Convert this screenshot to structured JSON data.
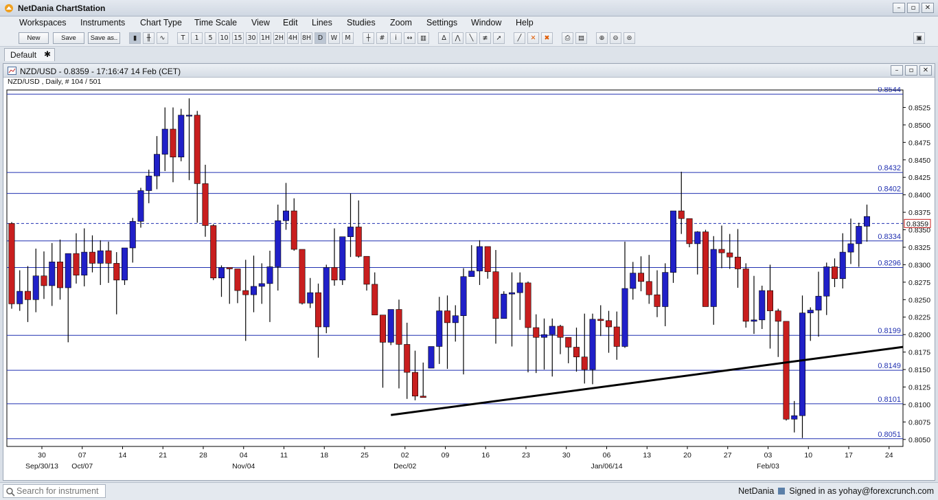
{
  "app": {
    "title": "NetDania ChartStation"
  },
  "menu": [
    "Workspaces",
    "Instruments",
    "Chart Type",
    "Time Scale",
    "View",
    "Edit",
    "Lines",
    "Studies",
    "Zoom",
    "Settings",
    "Window",
    "Help"
  ],
  "toolbar": {
    "new_label": "New",
    "save_label": "Save",
    "saveas_label": "Save as..",
    "timescales": [
      "T",
      "1",
      "5",
      "10",
      "15",
      "30",
      "1H",
      "2H",
      "4H",
      "8H",
      "D",
      "W",
      "M"
    ],
    "active_timescale": "D"
  },
  "workspace_tab": {
    "label": "Default",
    "close": "✱"
  },
  "chart_window": {
    "title": "NZD/USD - 0.8359 - 17:16:47  14 Feb (CET)",
    "subtitle": "NZD/USD , Daily, # 104 / 501"
  },
  "chart_data": {
    "type": "candlestick",
    "instrument": "NZD/USD",
    "ylim": [
      0.804,
      0.855
    ],
    "yticks": [
      "0.8525",
      "0.8500",
      "0.8475",
      "0.8450",
      "0.8425",
      "0.8400",
      "0.8375",
      "0.8350",
      "0.8325",
      "0.8300",
      "0.8275",
      "0.8250",
      "0.8225",
      "0.8200",
      "0.8175",
      "0.8150",
      "0.8125",
      "0.8100",
      "0.8075",
      "0.8050"
    ],
    "xticks": [
      "30",
      "07",
      "14",
      "21",
      "28",
      "04",
      "11",
      "18",
      "25",
      "02",
      "09",
      "16",
      "23",
      "30",
      "06",
      "13",
      "20",
      "27",
      "03",
      "10",
      "17",
      "24"
    ],
    "period_labels": [
      {
        "text": "Sep/30/13",
        "tick": 0
      },
      {
        "text": "Oct/07",
        "tick": 1
      },
      {
        "text": "Nov/04",
        "tick": 5
      },
      {
        "text": "Dec/02",
        "tick": 9
      },
      {
        "text": "Jan/06/14",
        "tick": 14
      },
      {
        "text": "Feb/03",
        "tick": 18
      }
    ],
    "hlines": [
      "0.8544",
      "0.8432",
      "0.8402",
      "0.8334",
      "0.8296",
      "0.8199",
      "0.8149",
      "0.8101",
      "0.8051"
    ],
    "current_price": "0.8359",
    "trendline": {
      "from": {
        "bar": 47,
        "price": 0.8085
      },
      "to": {
        "bar": 107,
        "price": 0.8177
      }
    },
    "candles": [
      [
        0.8359,
        0.8361,
        0.8237,
        0.8244
      ],
      [
        0.8244,
        0.8292,
        0.8234,
        0.8262
      ],
      [
        0.8262,
        0.8298,
        0.8218,
        0.825
      ],
      [
        0.825,
        0.8323,
        0.8232,
        0.8284
      ],
      [
        0.8284,
        0.8319,
        0.8251,
        0.827
      ],
      [
        0.827,
        0.8331,
        0.8241,
        0.8304
      ],
      [
        0.8304,
        0.8336,
        0.825,
        0.8267
      ],
      [
        0.8267,
        0.8316,
        0.8189,
        0.8316
      ],
      [
        0.8316,
        0.8345,
        0.8273,
        0.8285
      ],
      [
        0.8285,
        0.8352,
        0.8269,
        0.8318
      ],
      [
        0.8318,
        0.8342,
        0.8289,
        0.8302
      ],
      [
        0.8302,
        0.8335,
        0.8271,
        0.832
      ],
      [
        0.832,
        0.8333,
        0.8274,
        0.8302
      ],
      [
        0.8302,
        0.8318,
        0.8229,
        0.8278
      ],
      [
        0.8278,
        0.8318,
        0.8271,
        0.8324
      ],
      [
        0.8324,
        0.8367,
        0.8303,
        0.8362
      ],
      [
        0.8362,
        0.841,
        0.8353,
        0.8406
      ],
      [
        0.8406,
        0.8436,
        0.8388,
        0.8427
      ],
      [
        0.8427,
        0.8484,
        0.8408,
        0.8458
      ],
      [
        0.8458,
        0.8525,
        0.8434,
        0.8494
      ],
      [
        0.8494,
        0.8525,
        0.8418,
        0.8454
      ],
      [
        0.8454,
        0.8523,
        0.8448,
        0.8514
      ],
      [
        0.8514,
        0.8538,
        0.8421,
        0.8514
      ],
      [
        0.8514,
        0.852,
        0.836,
        0.8416
      ],
      [
        0.8416,
        0.8443,
        0.834,
        0.8356
      ],
      [
        0.8356,
        0.8358,
        0.8278,
        0.8281
      ],
      [
        0.8281,
        0.8299,
        0.8254,
        0.8296
      ],
      [
        0.8296,
        0.8294,
        0.8244,
        0.8294
      ],
      [
        0.8294,
        0.8282,
        0.8245,
        0.8263
      ],
      [
        0.8263,
        0.8307,
        0.8191,
        0.8257
      ],
      [
        0.8257,
        0.8313,
        0.8232,
        0.8269
      ],
      [
        0.8269,
        0.8302,
        0.8244,
        0.8273
      ],
      [
        0.8273,
        0.832,
        0.8218,
        0.8297
      ],
      [
        0.8297,
        0.8386,
        0.8263,
        0.8363
      ],
      [
        0.8363,
        0.8417,
        0.835,
        0.8377
      ],
      [
        0.8377,
        0.8395,
        0.832,
        0.8322
      ],
      [
        0.8322,
        0.83,
        0.8243,
        0.8245
      ],
      [
        0.8245,
        0.8281,
        0.8238,
        0.826
      ],
      [
        0.826,
        0.8273,
        0.8167,
        0.8211
      ],
      [
        0.8211,
        0.83,
        0.8202,
        0.8296
      ],
      [
        0.8296,
        0.8352,
        0.827,
        0.8278
      ],
      [
        0.8278,
        0.834,
        0.8271,
        0.834
      ],
      [
        0.834,
        0.8402,
        0.8311,
        0.8354
      ],
      [
        0.8354,
        0.8392,
        0.831,
        0.8312
      ],
      [
        0.8312,
        0.83,
        0.8263,
        0.8272
      ],
      [
        0.8272,
        0.8289,
        0.8228,
        0.8228
      ],
      [
        0.8228,
        0.8206,
        0.8124,
        0.8189
      ],
      [
        0.8189,
        0.8224,
        0.8185,
        0.8236
      ],
      [
        0.8236,
        0.825,
        0.8123,
        0.8186
      ],
      [
        0.8186,
        0.8217,
        0.8108,
        0.8146
      ],
      [
        0.8146,
        0.8177,
        0.8106,
        0.8112
      ],
      [
        0.8112,
        0.816,
        0.811,
        0.811
      ],
      [
        0.8152,
        0.818,
        0.8152,
        0.8183
      ],
      [
        0.8183,
        0.8254,
        0.8158,
        0.8234
      ],
      [
        0.8234,
        0.8256,
        0.8151,
        0.8217
      ],
      [
        0.8217,
        0.8242,
        0.819,
        0.8227
      ],
      [
        0.8227,
        0.8295,
        0.8143,
        0.8283
      ],
      [
        0.8283,
        0.8328,
        0.8284,
        0.8291
      ],
      [
        0.8291,
        0.8335,
        0.8271,
        0.8326
      ],
      [
        0.8326,
        0.8306,
        0.828,
        0.829
      ],
      [
        0.829,
        0.8321,
        0.8187,
        0.8223
      ],
      [
        0.8223,
        0.8262,
        0.8225,
        0.8258
      ],
      [
        0.8258,
        0.8289,
        0.8183,
        0.826
      ],
      [
        0.826,
        0.8289,
        0.8221,
        0.8274
      ],
      [
        0.8274,
        0.8276,
        0.8146,
        0.821
      ],
      [
        0.821,
        0.8229,
        0.8145,
        0.8196
      ],
      [
        0.8196,
        0.8223,
        0.815,
        0.82
      ],
      [
        0.82,
        0.8223,
        0.814,
        0.8212
      ],
      [
        0.8212,
        0.8214,
        0.8172,
        0.8196
      ],
      [
        0.8196,
        0.8196,
        0.8159,
        0.8182
      ],
      [
        0.8182,
        0.821,
        0.8147,
        0.8168
      ],
      [
        0.8168,
        0.823,
        0.813,
        0.815
      ],
      [
        0.815,
        0.823,
        0.8129,
        0.8222
      ],
      [
        0.8222,
        0.8242,
        0.8198,
        0.822
      ],
      [
        0.822,
        0.8234,
        0.8174,
        0.8211
      ],
      [
        0.8211,
        0.8233,
        0.8164,
        0.8183
      ],
      [
        0.8183,
        0.8333,
        0.8181,
        0.8266
      ],
      [
        0.8266,
        0.8304,
        0.825,
        0.8288
      ],
      [
        0.8288,
        0.8312,
        0.8262,
        0.8276
      ],
      [
        0.8276,
        0.8314,
        0.8244,
        0.8257
      ],
      [
        0.8257,
        0.8292,
        0.8225,
        0.824
      ],
      [
        0.824,
        0.8302,
        0.8212,
        0.8289
      ],
      [
        0.8289,
        0.8373,
        0.8274,
        0.8377
      ],
      [
        0.8377,
        0.8433,
        0.8344,
        0.8366
      ],
      [
        0.8366,
        0.8366,
        0.8325,
        0.833
      ],
      [
        0.833,
        0.8348,
        0.8286,
        0.8347
      ],
      [
        0.8347,
        0.835,
        0.824,
        0.824
      ],
      [
        0.824,
        0.8341,
        0.8214,
        0.8322
      ],
      [
        0.8322,
        0.8356,
        0.8295,
        0.8317
      ],
      [
        0.8317,
        0.8344,
        0.8294,
        0.8311
      ],
      [
        0.8311,
        0.8351,
        0.8267,
        0.8294
      ],
      [
        0.8294,
        0.8302,
        0.821,
        0.8219
      ],
      [
        0.8219,
        0.8284,
        0.8201,
        0.8221
      ],
      [
        0.8221,
        0.827,
        0.8208,
        0.8263
      ],
      [
        0.8263,
        0.83,
        0.818,
        0.8234
      ],
      [
        0.8234,
        0.8237,
        0.8168,
        0.8219
      ],
      [
        0.8219,
        0.8177,
        0.8077,
        0.8079
      ],
      [
        0.8079,
        0.8105,
        0.806,
        0.8084
      ],
      [
        0.8084,
        0.8256,
        0.8052,
        0.8231
      ],
      [
        0.8231,
        0.8239,
        0.8191,
        0.8235
      ],
      [
        0.8235,
        0.829,
        0.8197,
        0.8255
      ],
      [
        0.8255,
        0.8303,
        0.8228,
        0.8297
      ],
      [
        0.8297,
        0.8309,
        0.8268,
        0.828
      ],
      [
        0.828,
        0.8345,
        0.8266,
        0.8318
      ],
      [
        0.8318,
        0.8366,
        0.8301,
        0.833
      ],
      [
        0.833,
        0.836,
        0.8297,
        0.8355
      ],
      [
        0.8355,
        0.8386,
        0.8333,
        0.8369
      ]
    ]
  },
  "status": {
    "search_placeholder": "Search for instrument",
    "brand": "NetDania",
    "signed_in": "Signed in as yohay@forexcrunch.com"
  },
  "colors": {
    "up": "#2020c8",
    "down": "#c81e1e",
    "hline": "#1f2fb0"
  }
}
